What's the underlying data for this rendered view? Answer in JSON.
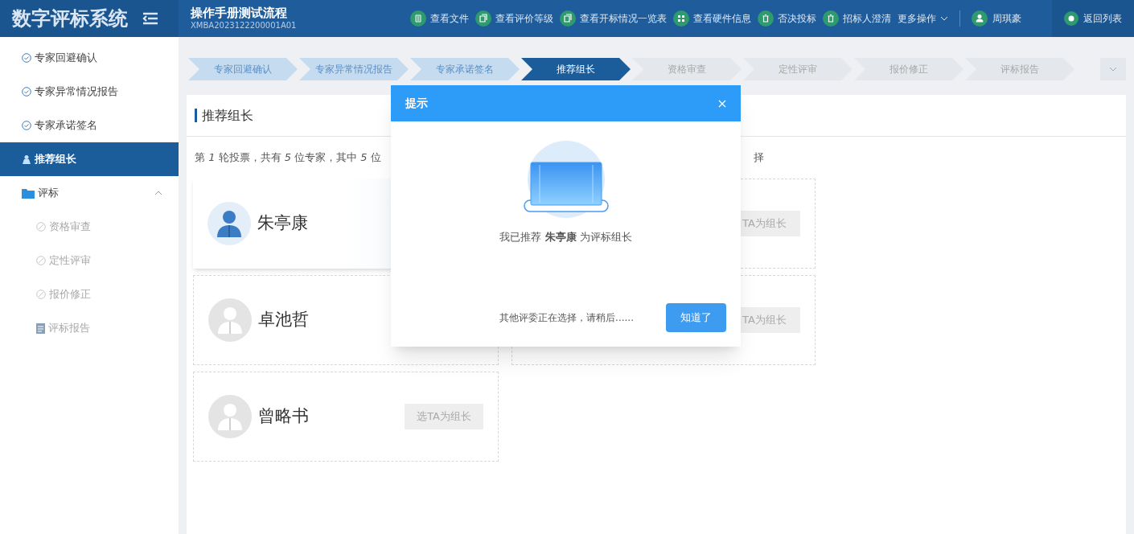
{
  "header": {
    "logo": "数字评标系统",
    "project_title": "操作手册测试流程",
    "project_code": "XMBA2023122200001A01",
    "actions": [
      {
        "label": "查看文件",
        "kind": "doc"
      },
      {
        "label": "查看评价等级",
        "kind": "copy"
      },
      {
        "label": "查看开标情况一览表",
        "kind": "copy"
      },
      {
        "label": "查看硬件信息",
        "kind": "grid"
      },
      {
        "label": "否决投标",
        "kind": "trash"
      },
      {
        "label": "招标人澄清",
        "kind": "trash"
      },
      {
        "label": "更多操作",
        "kind": "more"
      }
    ],
    "user": "周琪豪",
    "back": "返回列表"
  },
  "sidebar": {
    "items": [
      {
        "label": "专家回避确认",
        "kind": "done",
        "selected": false
      },
      {
        "label": "专家异常情况报告",
        "kind": "done",
        "selected": false
      },
      {
        "label": "专家承诺签名",
        "kind": "done",
        "selected": false
      },
      {
        "label": "推荐组长",
        "kind": "leader",
        "selected": true
      },
      {
        "label": "评标",
        "kind": "folder",
        "selected": false,
        "expanded": true,
        "children": [
          {
            "label": "资格审查",
            "kind": "pending",
            "selected": false
          },
          {
            "label": "定性评审",
            "kind": "pending",
            "selected": false
          },
          {
            "label": "报价修正",
            "kind": "pending",
            "selected": false
          },
          {
            "label": "评标报告",
            "kind": "report",
            "selected": false
          }
        ]
      }
    ]
  },
  "steps": [
    {
      "label": "专家回避确认",
      "kind": "done"
    },
    {
      "label": "专家异常情况报告",
      "kind": "done"
    },
    {
      "label": "专家承诺签名",
      "kind": "done"
    },
    {
      "label": "推荐组长",
      "kind": "current"
    },
    {
      "label": "资格审查",
      "kind": "pending"
    },
    {
      "label": "定性评审",
      "kind": "pending"
    },
    {
      "label": "报价修正",
      "kind": "pending"
    },
    {
      "label": "评标报告",
      "kind": "pending"
    }
  ],
  "panel": {
    "title": "推荐组长",
    "info": "第 *1* 轮投票，共有 *5* 位专家，其中 *5* 位",
    "info_tail": "择",
    "experts": [
      {
        "name": "朱亭康",
        "selected": true
      },
      {
        "button": "TA为组长",
        "selected": false
      },
      {
        "name": "卓池哲",
        "selected": false
      },
      {
        "button": "TA为组长",
        "selected": false
      },
      {
        "name": "曾略书",
        "button": "选TA为组长",
        "selected": false
      }
    ]
  },
  "dialog": {
    "title": "提示",
    "message": "我已推荐 **朱亭康** 为评标组长",
    "note": "其他评委正在选择，请稍后......",
    "confirm": "知道了"
  }
}
